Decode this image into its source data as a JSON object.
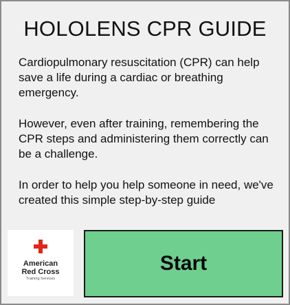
{
  "header": {
    "title": "HOLOLENS CPR GUIDE"
  },
  "intro": {
    "paragraph1": "Cardiopulmonary resuscitation (CPR) can help save a life during a cardiac or breathing emergency.",
    "paragraph2": "However, even after training, remembering the CPR steps and administering them correctly can be a challenge.",
    "paragraph3": "In order to help you help someone in need, we've created this simple step-by-step guide"
  },
  "logo": {
    "line1": "American",
    "line2": "Red Cross",
    "line3": "Training Services",
    "color": "#e1251b"
  },
  "actions": {
    "start_label": "Start",
    "start_color": "#6fcf8f"
  }
}
